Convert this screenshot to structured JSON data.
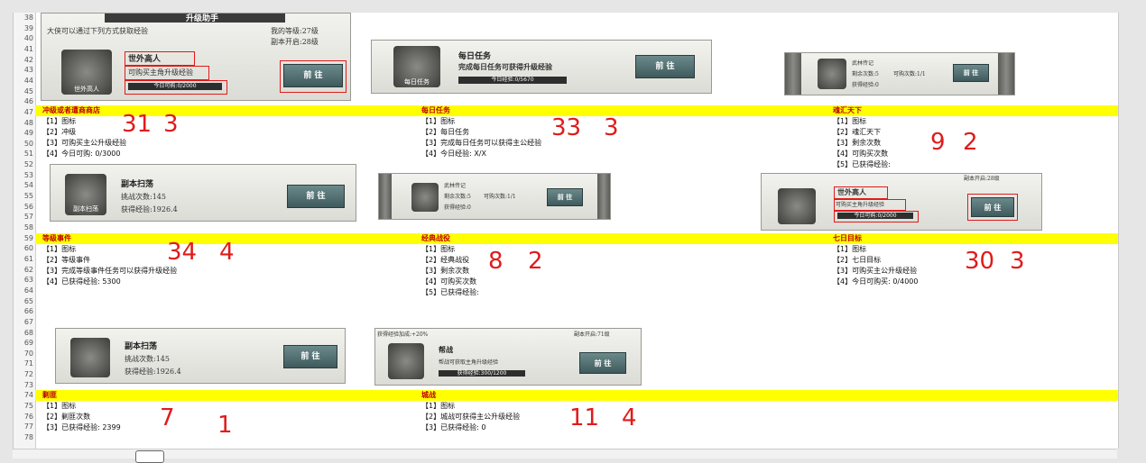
{
  "row_numbers": [
    "38",
    "39",
    "40",
    "41",
    "42",
    "43",
    "44",
    "45",
    "46",
    "47",
    "48",
    "49",
    "50",
    "51",
    "52",
    "53",
    "54",
    "55",
    "56",
    "57",
    "58",
    "59",
    "60",
    "61",
    "62",
    "63",
    "64",
    "65",
    "66",
    "67",
    "68",
    "69",
    "70",
    "71",
    "72",
    "73",
    "74",
    "75",
    "76",
    "77",
    "78"
  ],
  "top_panel": {
    "header": "升级助手",
    "line1": "大侠可以通过下列方式获取经验",
    "my_level": "我的等级:27级",
    "dungeon_open": "副本开启:28级",
    "name": "世外高人",
    "desc": "可购买主角升级经验",
    "today": "今日可购:0/2000",
    "icon_label": "世外高人",
    "btn": "前 往"
  },
  "daily_panel": {
    "title": "每日任务",
    "desc": "完成每日任务可获得升级经验",
    "exp": "今日经验:0/5670",
    "icon_label": "每日任务",
    "btn": "前 往"
  },
  "wulin_panel": {
    "title": "武林传记",
    "remain": "剩余次数:5",
    "buy": "可购次数:1/1",
    "got": "获得经验:0",
    "btn": "前 往"
  },
  "sections": {
    "s1": {
      "title": "冲级或者遭商商店",
      "lines": [
        "【1】图标",
        "【2】冲级",
        "【3】可购买主公升级经验",
        "【4】今日可购: 0/3000"
      ],
      "n1": "31",
      "n2": "3"
    },
    "s2": {
      "title": "每日任务",
      "lines": [
        "【1】图标",
        "【2】每日任务",
        "【3】完成每日任务可以获得主公经验",
        "【4】今日经验: X/X"
      ],
      "n1": "33",
      "n2": "3"
    },
    "s3": {
      "title": "魂汇天下",
      "lines": [
        "【1】图标",
        "【2】魂汇天下",
        "【3】剩余次数",
        "【4】可购买次数",
        "【5】已获得经验:"
      ],
      "n1": "9",
      "n2": "2"
    },
    "s4": {
      "title": "等级事件",
      "lines": [
        "【1】图标",
        "【2】等级事件",
        "【3】完成等级事件任务可以获得升级经验",
        "【4】已获得经验: 5300"
      ],
      "n1": "34",
      "n2": "4"
    },
    "s5": {
      "title": "经典战役",
      "lines": [
        "【1】图标",
        "【2】经典战役",
        "【3】剩余次数",
        "【4】可购买次数",
        "【5】已获得经验:"
      ],
      "n1": "8",
      "n2": "2"
    },
    "s6": {
      "title": "七日目标",
      "lines": [
        "【1】图标",
        "【2】七日目标",
        "【3】可购买主公升级经验",
        "【4】今日可购买: 0/4000"
      ],
      "n1": "30",
      "n2": "3"
    },
    "s7": {
      "title": "剿匪",
      "lines": [
        "【1】图标",
        "【2】剿匪次数",
        "【3】已获得经验: 2399"
      ],
      "n1": "7",
      "n2": "1"
    },
    "s8": {
      "title": "城战",
      "lines": [
        "【1】图标",
        "【2】城战可获得主公升级经验",
        "【3】已获得经验: 0"
      ],
      "n1": "11",
      "n2": "4"
    }
  },
  "sweep_panel": {
    "title": "副本扫荡",
    "count": "挑战次数:145",
    "exp": "获得经验:1926.4",
    "icon_label": "副本扫荡",
    "btn": "前 往"
  },
  "wulin2": {
    "title": "武林传记",
    "remain": "剩余次数:5",
    "buy": "可购次数:1/1",
    "got": "获得经验:0",
    "btn": "前 往"
  },
  "world_panel": {
    "dungeon_open": "副本开启:28级",
    "name": "世外高人",
    "desc": "可购买主角升级经验",
    "today": "今日可购:0/2000",
    "btn": "前 往"
  },
  "sweep2": {
    "title": "副本扫荡",
    "count": "挑战次数:145",
    "exp": "获得经验:1926.4",
    "btn": "前 往"
  },
  "help_panel": {
    "bonus": "获得经验加成:+20%",
    "dungeon_open": "副本开启:71级",
    "title": "帮战",
    "desc": "帮战可获取主角升级经验",
    "progress": "获得经验:300/1200",
    "btn": "前 往"
  }
}
